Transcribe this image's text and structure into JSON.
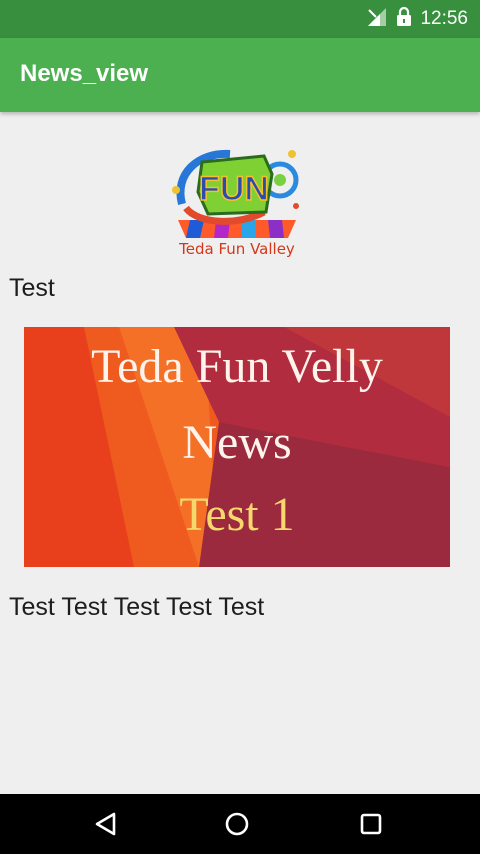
{
  "status_bar": {
    "time": "12:56",
    "icons": [
      "signal-icon",
      "lock-icon"
    ]
  },
  "app_bar": {
    "title": "News_view"
  },
  "logo": {
    "mark_text": "FUN",
    "caption": "Teda Fun Valley"
  },
  "news": {
    "title": "Test",
    "banner_lines": [
      "Teda Fun Velly",
      "News",
      "Test 1"
    ],
    "body": "Test Test Test Test Test"
  },
  "nav_bar": {
    "buttons": [
      "back-icon",
      "home-icon",
      "recents-icon"
    ]
  },
  "colors": {
    "status_bar": "#38903f",
    "app_bar": "#4caf50",
    "background": "#efefef",
    "banner_highlight": "#f6d86c"
  }
}
